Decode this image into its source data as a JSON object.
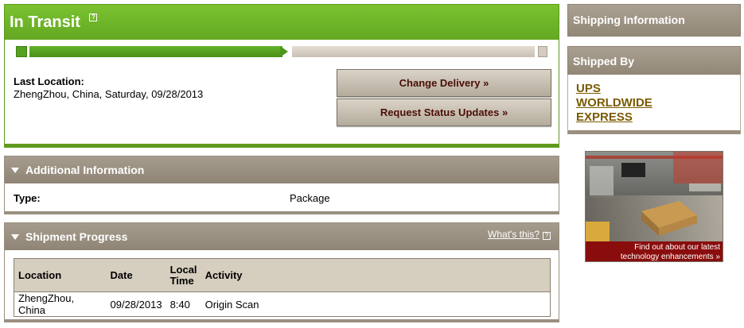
{
  "status": {
    "title": "In Transit",
    "help_glyph": "?",
    "progress_fraction": 0.5,
    "accent": "#63a821"
  },
  "last_location": {
    "label": "Last Location:",
    "value": "ZhengZhou, China, Saturday, 09/28/2013"
  },
  "actions": {
    "change_delivery": "Change Delivery »",
    "request_updates": "Request Status Updates »"
  },
  "additional_info": {
    "heading": "Additional Information",
    "type_label": "Type:",
    "type_value": "Package"
  },
  "shipment_progress": {
    "heading": "Shipment Progress",
    "whats_this": "What's this?",
    "columns": [
      "Location",
      "Date",
      "Local Time",
      "Activity"
    ],
    "rows": [
      [
        "ZhengZhou, China",
        "09/28/2013",
        "8:40",
        "Origin Scan"
      ]
    ]
  },
  "sidebar": {
    "shipping_info": "Shipping Information",
    "shipped_by_heading": "Shipped By",
    "carrier_lines": [
      "UPS",
      "WORLDWIDE",
      "EXPRESS"
    ]
  },
  "promo": {
    "caption_line1": "Find out about our latest",
    "caption_line2": "technology enhancements »"
  },
  "colors": {
    "brand_green": "#63a821",
    "panel_brown": "#978c7c",
    "button_text": "#4b0f06",
    "link_gold": "#7a5a00",
    "promo_red": "#8a0d0d"
  }
}
